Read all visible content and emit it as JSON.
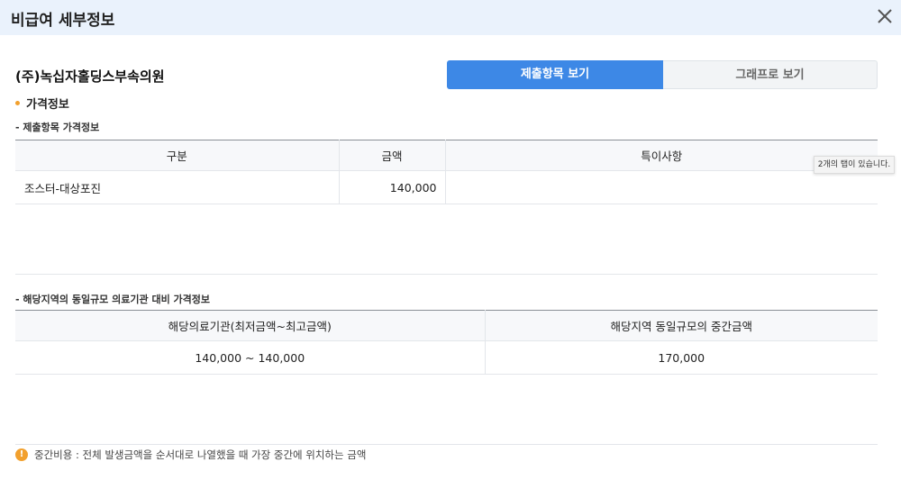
{
  "header": {
    "title": "비급여 세부정보",
    "close_icon": "close-icon"
  },
  "hospital": {
    "name": "(주)녹십자홀딩스부속의원"
  },
  "tabs": [
    {
      "label": "제출항목 보기",
      "active": true
    },
    {
      "label": "그래프로 보기",
      "active": false
    }
  ],
  "price_info": {
    "heading": "가격정보",
    "submitted_heading": "- 제출항목 가격정보",
    "columns": [
      "구분",
      "금액",
      "특이사항"
    ],
    "rows": [
      {
        "category": "조스터-대상포진",
        "amount": "140,000",
        "note": ""
      }
    ]
  },
  "tooltip": {
    "text": "2개의 탭이 있습니다."
  },
  "comparison": {
    "heading": "- 해당지역의 동일규모 의료기관 대비 가격정보",
    "columns": [
      "해당의료기관(최저금액~최고금액)",
      "해당지역 동일규모의 중간금액"
    ],
    "rows": [
      {
        "range": "140,000 ~ 140,000",
        "median": "170,000"
      }
    ]
  },
  "notice": {
    "icon": "info-icon",
    "icon_glyph": "!",
    "text": "중간비용 : 전체 발생금액을 순서대로 나열했을 때 가장 중간에 위치하는 금액"
  },
  "colors": {
    "header_bg": "#eaf2fc",
    "accent": "#3d88e6",
    "bullet": "#f2a02d"
  }
}
